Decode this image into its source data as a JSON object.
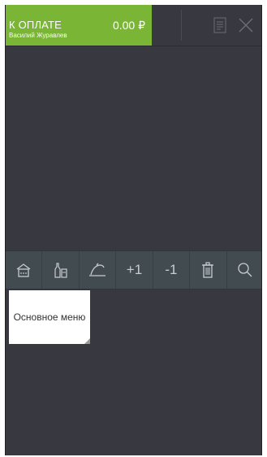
{
  "header": {
    "payment_label": "К ОПЛАТЕ",
    "user_name": "Василий Журавлев",
    "amount": "0.00 ₽",
    "accent_color": "#7ab536"
  },
  "toolbar": {
    "home_icon": "home-icon",
    "bottles_icon": "bottles-icon",
    "dish_icon": "serving-dish-icon",
    "plus_label": "+1",
    "minus_label": "-1",
    "trash_icon": "trash-icon",
    "search_icon": "search-icon"
  },
  "menu": {
    "tile_label": "Основное меню"
  },
  "colors": {
    "background": "#383841",
    "toolbar": "#424b50"
  }
}
